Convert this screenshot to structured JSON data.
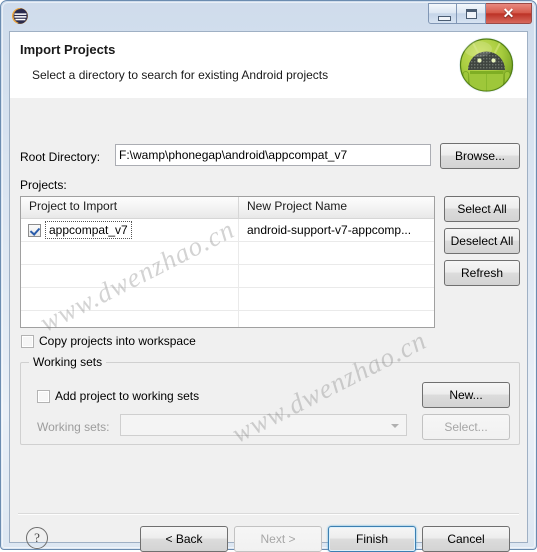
{
  "window": {
    "app_icon": "eclipse-icon",
    "controls": {
      "minimize": "minimize-icon",
      "maximize": "maximize-icon",
      "close": "✕"
    }
  },
  "banner": {
    "title": "Import Projects",
    "subtitle": "Select a directory to search for existing Android projects",
    "logo": "android-robot-icon"
  },
  "form": {
    "root_directory_label": "Root Directory:",
    "root_directory_value": "F:\\wamp\\phonegap\\android\\appcompat_v7",
    "root_directory_placeholder": "",
    "browse_label": "Browse...",
    "projects_label": "Projects:"
  },
  "table": {
    "columns": [
      "Project to Import",
      "New Project Name"
    ],
    "rows": [
      {
        "checked": true,
        "project_to_import": "appcompat_v7",
        "new_project_name": "android-support-v7-appcomp..."
      }
    ],
    "empty_row_count": 4
  },
  "side_buttons": [
    {
      "label": "Select All",
      "name": "select-all-button",
      "enabled": true
    },
    {
      "label": "Deselect All",
      "name": "deselect-all-button",
      "enabled": true
    },
    {
      "label": "Refresh",
      "name": "refresh-button",
      "enabled": true
    }
  ],
  "options": {
    "copy_projects_label": "Copy projects into workspace",
    "copy_projects_checked": false
  },
  "working_sets": {
    "group_label": "Working sets",
    "add_project_label": "Add project to working sets",
    "add_project_checked": false,
    "working_sets_label": "Working sets:",
    "working_sets_value": "",
    "new_label": "New...",
    "select_label": "Select..."
  },
  "footer": {
    "help_label": "?",
    "buttons": [
      {
        "label": "< Back",
        "name": "back-button",
        "enabled": true,
        "default": false
      },
      {
        "label": "Next >",
        "name": "next-button",
        "enabled": false,
        "default": false
      },
      {
        "label": "Finish",
        "name": "finish-button",
        "enabled": true,
        "default": true
      },
      {
        "label": "Cancel",
        "name": "cancel-button",
        "enabled": true,
        "default": false
      }
    ]
  },
  "watermarks": [
    {
      "text": "www.dwenzhao.cn"
    },
    {
      "text": "www.dwenzhao.cn"
    }
  ],
  "colors": {
    "accent": "#3c7fb1",
    "close_button": "#bc3326",
    "android_green": "#a4c639",
    "dialog_bg": "#f0f0f0"
  }
}
